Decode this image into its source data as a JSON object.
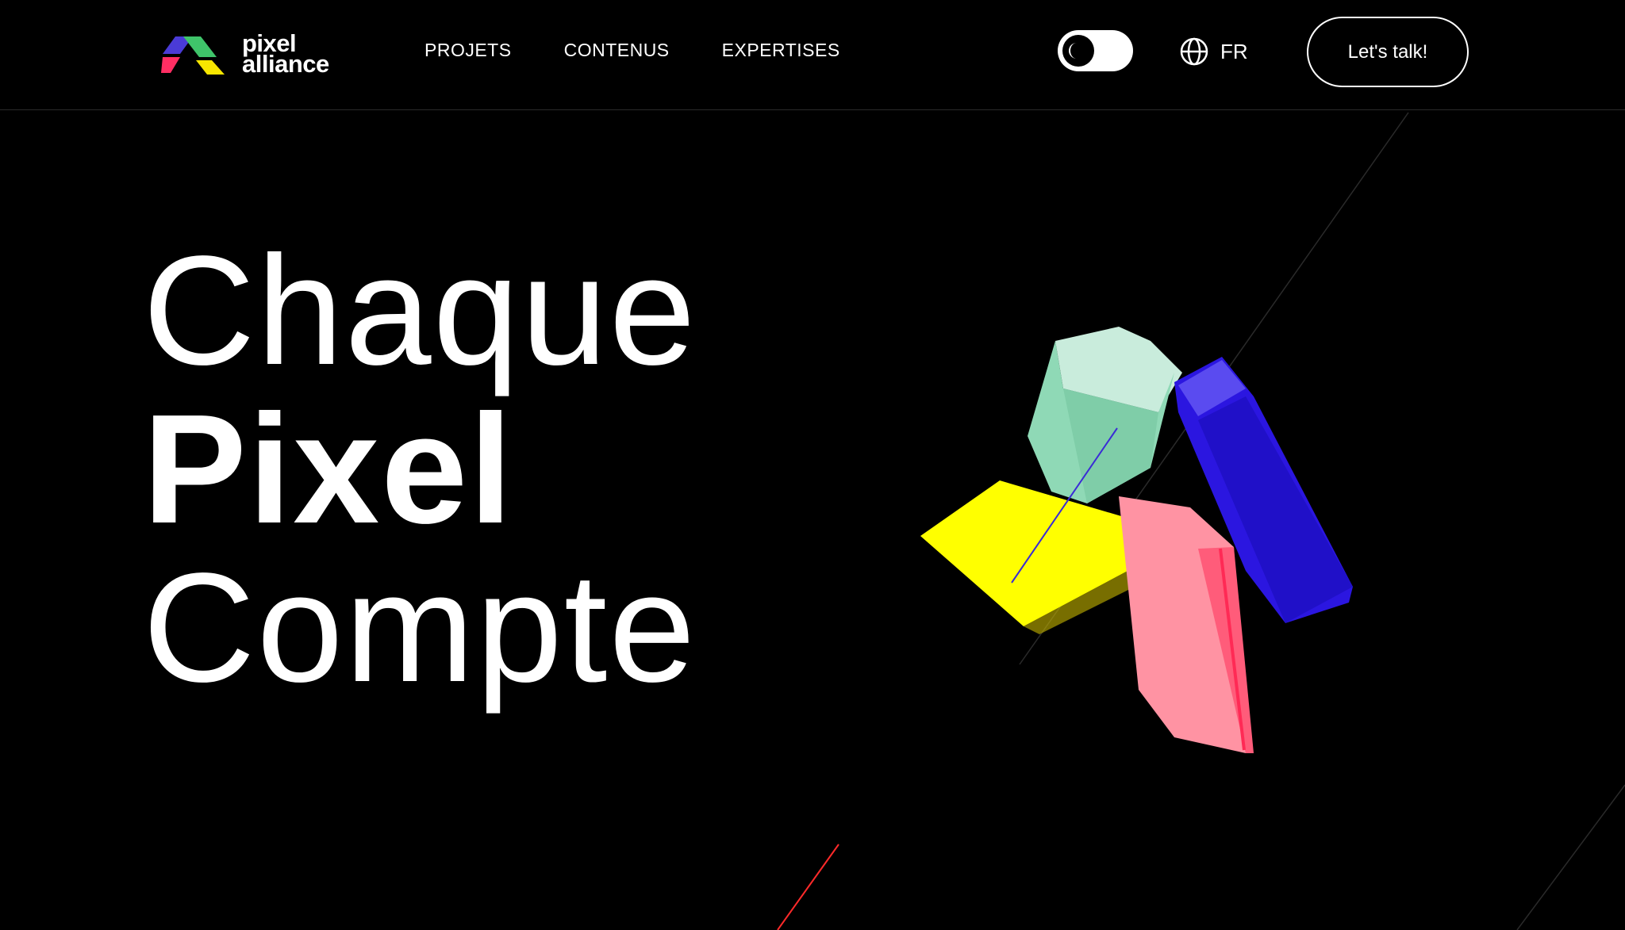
{
  "brand": {
    "name_line1": "pixel",
    "name_line2": "alliance",
    "logo_colors": [
      "#4a3bd6",
      "#3fc46a",
      "#ff2e63",
      "#f7e600"
    ]
  },
  "nav": {
    "items": [
      {
        "label": "PROJETS"
      },
      {
        "label": "CONTENUS"
      },
      {
        "label": "EXPERTISES"
      }
    ]
  },
  "theme_toggle": {
    "icon": "moon-icon",
    "state": "dark"
  },
  "language": {
    "icon": "globe-icon",
    "label": "FR"
  },
  "cta": {
    "label": "Let's talk!"
  },
  "hero": {
    "line1": "Chaque",
    "line2": "Pixel",
    "line3": "Compte"
  },
  "colors": {
    "background": "#000000",
    "text": "#ffffff",
    "yellow": "#ffff00",
    "mint": "#8fd9b6",
    "blue": "#2b16e0",
    "pink": "#ff6b86"
  }
}
